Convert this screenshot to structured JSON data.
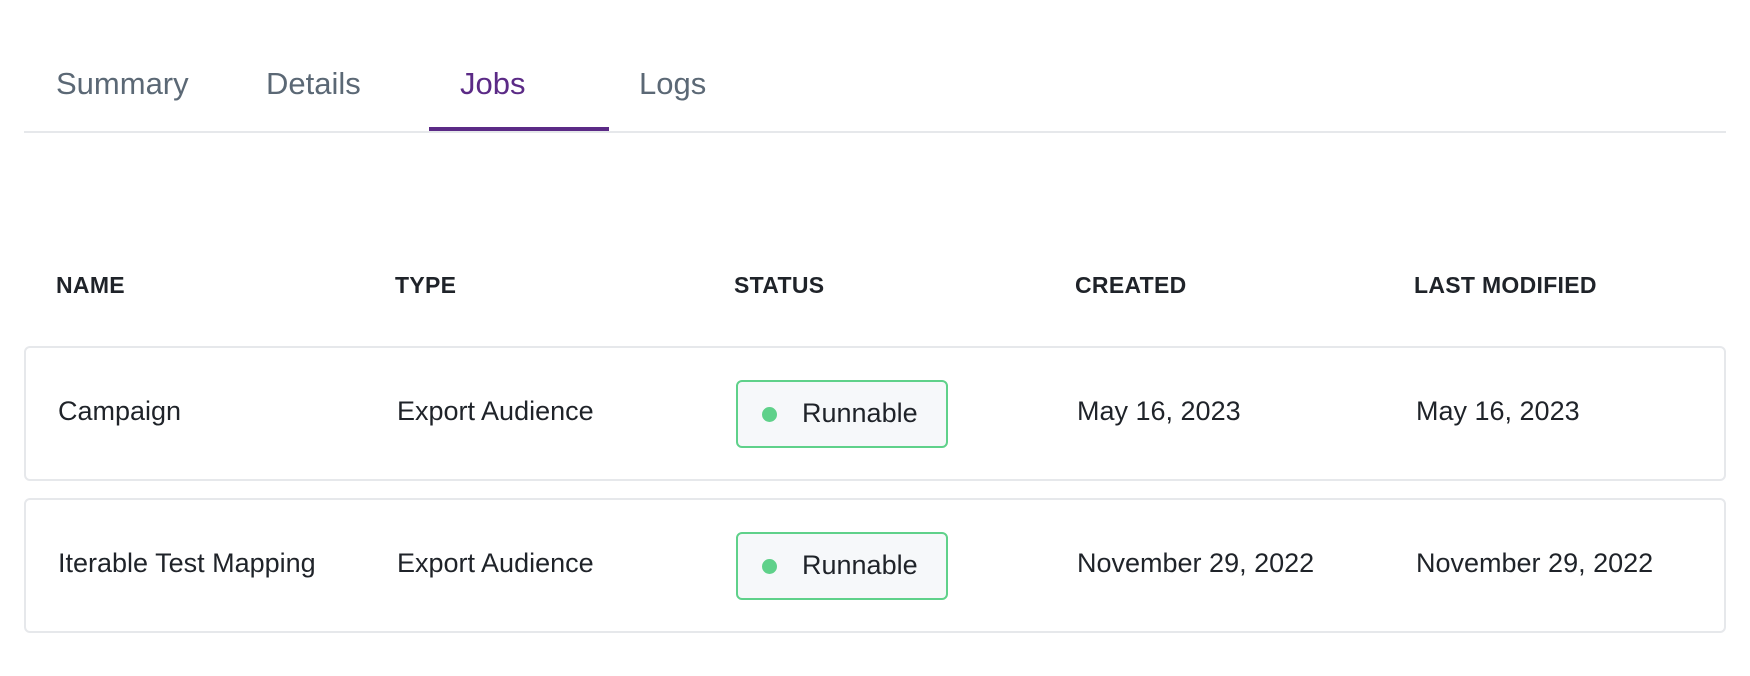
{
  "tabs": [
    {
      "label": "Summary",
      "active": false
    },
    {
      "label": "Details",
      "active": false
    },
    {
      "label": "Jobs",
      "active": true
    },
    {
      "label": "Logs",
      "active": false
    }
  ],
  "table": {
    "headers": [
      "NAME",
      "TYPE",
      "STATUS",
      "CREATED",
      "LAST MODIFIED"
    ],
    "rows": [
      {
        "name": "Campaign",
        "type": "Export Audience",
        "status": "Runnable",
        "created": "May 16, 2023",
        "last_modified": "May 16, 2023"
      },
      {
        "name": "Iterable Test Mapping",
        "type": "Export Audience",
        "status": "Runnable",
        "created": "November 29, 2022",
        "last_modified": "November 29, 2022"
      }
    ]
  },
  "colors": {
    "accent": "#5b2a86",
    "status_green": "#5fd18a",
    "status_dot": "#5fd18a"
  }
}
